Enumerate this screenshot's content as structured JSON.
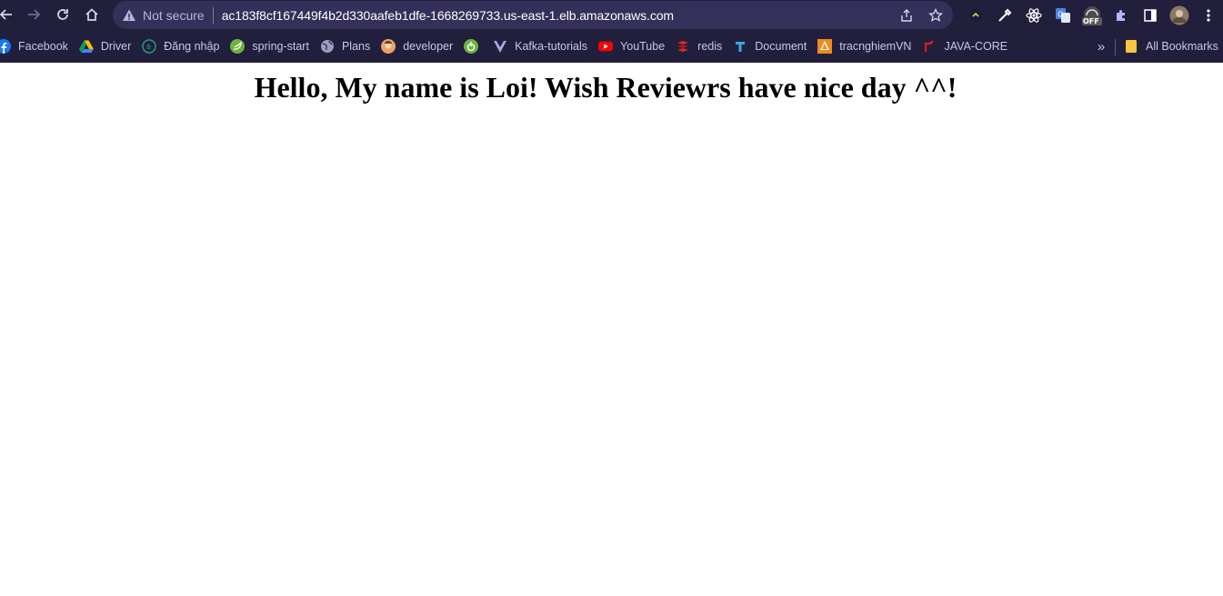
{
  "browser": {
    "security_label": "Not secure",
    "url": "ac183f8cf167449f4b2d330aafeb1dfe-1668269733.us-east-1.elb.amazonaws.com",
    "nav_icons": [
      "back-arrow-icon",
      "forward-arrow-icon",
      "reload-icon",
      "home-icon"
    ],
    "omnibox_icons": [
      "share-icon",
      "star-icon"
    ],
    "extension_icons": [
      "extension-green-icon",
      "eyedropper-icon",
      "react-devtools-icon",
      "google-translate-icon",
      "speedometer-off-icon",
      "puzzle-extensions-icon",
      "side-panel-icon",
      "profile-avatar",
      "kebab-menu-icon"
    ],
    "extension_badge": "OFF",
    "colors": {
      "toolbar": "#221f3d",
      "omnibox": "#34305a",
      "accent": "#c9c6ee"
    }
  },
  "bookmarks": {
    "items": [
      {
        "label": "Facebook",
        "icon": "facebook-icon"
      },
      {
        "label": "Driver",
        "icon": "google-drive-icon"
      },
      {
        "label": "Đăng nhập",
        "icon": "login-icon"
      },
      {
        "label": "spring-start",
        "icon": "spring-icon"
      },
      {
        "label": "Plans",
        "icon": "globe-icon"
      },
      {
        "label": "developer",
        "icon": "developer-avatar-icon"
      },
      {
        "label": "",
        "icon": "spring-boot-icon"
      },
      {
        "label": "Kafka-tutorials",
        "icon": "vuejs-icon"
      },
      {
        "label": "YouTube",
        "icon": "youtube-icon"
      },
      {
        "label": "redis",
        "icon": "redis-icon"
      },
      {
        "label": "Document",
        "icon": "document-icon"
      },
      {
        "label": "tracnghiemVN",
        "icon": "tracnghiem-icon"
      },
      {
        "label": "JAVA-CORE",
        "icon": "java-icon"
      }
    ],
    "more_label": "»",
    "all_label": "All Bookmarks"
  },
  "page": {
    "heading": "Hello, My name is Loi! Wish Reviewrs have nice day ^^!"
  }
}
